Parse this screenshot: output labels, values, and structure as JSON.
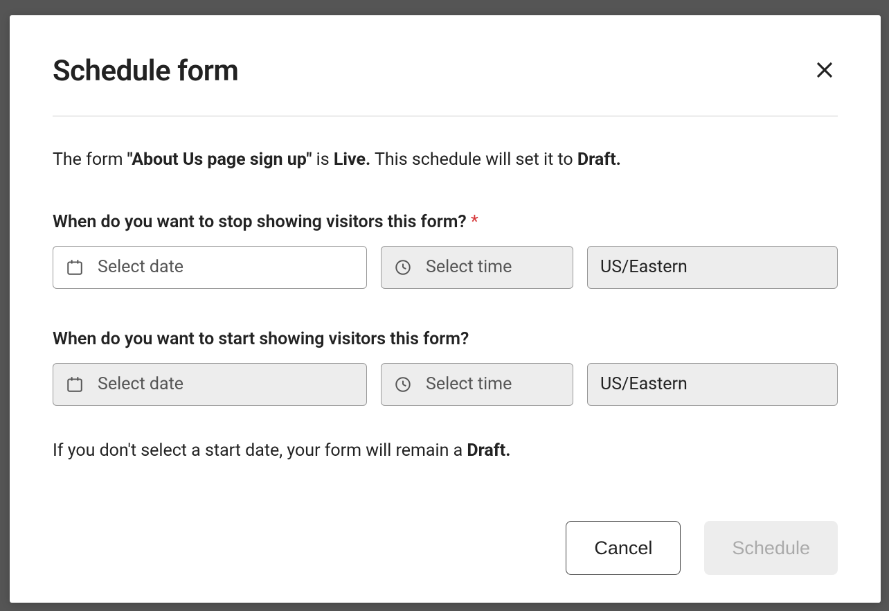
{
  "modal": {
    "title": "Schedule form",
    "status": {
      "prefix": "The form ",
      "form_name": "\"About Us page sign up\"",
      "mid1": " is ",
      "state": "Live.",
      "mid2": " This schedule will set it to ",
      "target": "Draft."
    },
    "stop": {
      "label": "When do you want to stop showing visitors this form?",
      "required_mark": "*",
      "date_placeholder": "Select date",
      "time_placeholder": "Select time",
      "timezone": "US/Eastern"
    },
    "start": {
      "label": "When do you want to start showing visitors this form?",
      "date_placeholder": "Select date",
      "time_placeholder": "Select time",
      "timezone": "US/Eastern"
    },
    "hint": {
      "prefix": "If you don't select a start date, your form will remain a ",
      "bold": "Draft."
    },
    "buttons": {
      "cancel": "Cancel",
      "schedule": "Schedule"
    }
  }
}
